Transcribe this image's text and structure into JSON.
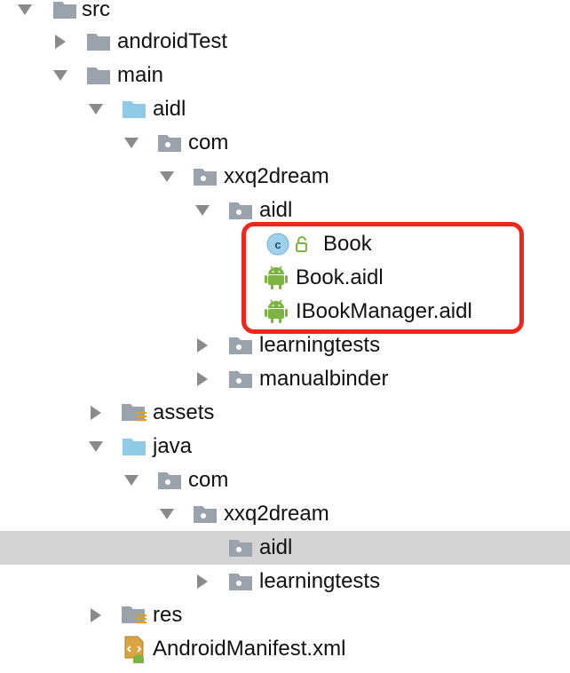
{
  "tree": {
    "nodes": [
      {
        "name": "tree-node-src",
        "label": "src",
        "state": "expanded",
        "icon": "folder-icon"
      },
      {
        "name": "tree-node-androidtest",
        "label": "androidTest",
        "state": "collapsed",
        "icon": "folder-icon"
      },
      {
        "name": "tree-node-main",
        "label": "main",
        "state": "expanded",
        "icon": "folder-icon"
      },
      {
        "name": "tree-node-main-aidl",
        "label": "aidl",
        "state": "expanded",
        "icon": "source-folder-icon"
      },
      {
        "name": "tree-node-aidl-com",
        "label": "com",
        "state": "expanded",
        "icon": "package-icon"
      },
      {
        "name": "tree-node-aidl-xxq2dream",
        "label": "xxq2dream",
        "state": "expanded",
        "icon": "package-icon"
      },
      {
        "name": "tree-node-aidl-aidl-package",
        "label": "aidl",
        "state": "expanded",
        "icon": "package-icon"
      },
      {
        "name": "tree-node-book-class",
        "label": "Book",
        "state": "leaf",
        "icon": "class-icon"
      },
      {
        "name": "tree-node-book-aidl",
        "label": "Book.aidl",
        "state": "leaf",
        "icon": "android-icon"
      },
      {
        "name": "tree-node-ibookmanager-aidl",
        "label": "IBookManager.aidl",
        "state": "leaf",
        "icon": "android-icon"
      },
      {
        "name": "tree-node-aidl-learningtests",
        "label": "learningtests",
        "state": "collapsed",
        "icon": "package-icon"
      },
      {
        "name": "tree-node-manualbinder",
        "label": "manualbinder",
        "state": "collapsed",
        "icon": "package-icon"
      },
      {
        "name": "tree-node-assets",
        "label": "assets",
        "state": "collapsed",
        "icon": "resource-folder-icon"
      },
      {
        "name": "tree-node-java",
        "label": "java",
        "state": "expanded",
        "icon": "source-folder-icon"
      },
      {
        "name": "tree-node-java-com",
        "label": "com",
        "state": "expanded",
        "icon": "package-icon"
      },
      {
        "name": "tree-node-java-xxq2dream",
        "label": "xxq2dream",
        "state": "expanded",
        "icon": "package-icon"
      },
      {
        "name": "tree-node-java-aidl-package",
        "label": "aidl",
        "state": "leaf",
        "icon": "package-icon"
      },
      {
        "name": "tree-node-java-learningtests",
        "label": "learningtests",
        "state": "collapsed",
        "icon": "package-icon"
      },
      {
        "name": "tree-node-res",
        "label": "res",
        "state": "collapsed",
        "icon": "resource-folder-icon"
      },
      {
        "name": "tree-node-manifest",
        "label": "AndroidManifest.xml",
        "state": "leaf",
        "icon": "manifest-icon"
      }
    ],
    "selected": "tree-node-java-aidl-package"
  },
  "annotation": {
    "highlight_color": "#f0251b"
  },
  "colors": {
    "folder_gray": "#9aa3ab",
    "folder_blue": "#8fcae6",
    "android_green": "#7cb342",
    "class_circle": "#9fd1ea",
    "selection_bg": "#d4d4d4"
  }
}
